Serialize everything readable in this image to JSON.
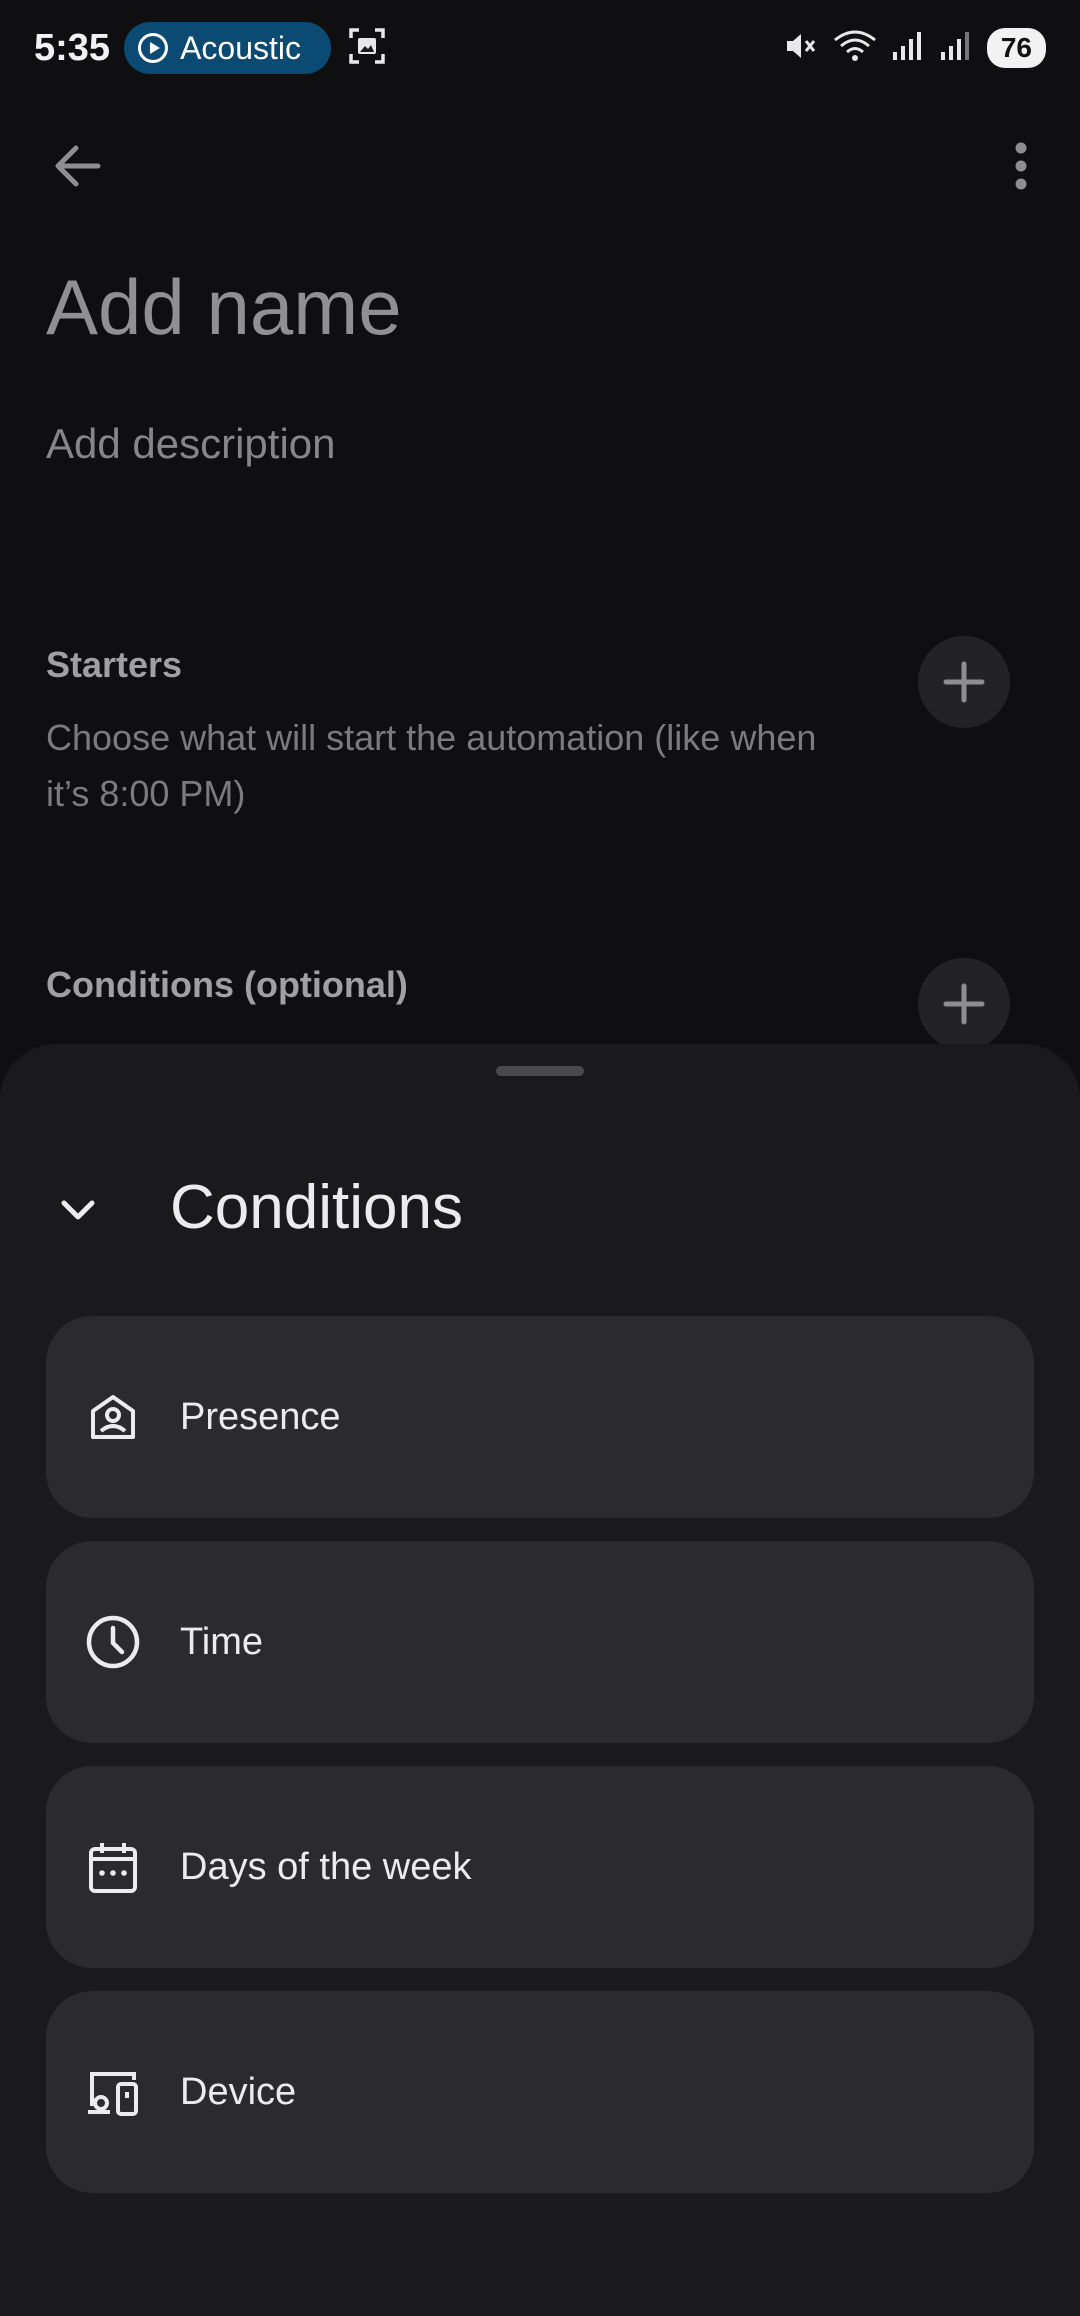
{
  "status_bar": {
    "time": "5:35",
    "media_label": "Acoustic",
    "battery": "76"
  },
  "page": {
    "name_placeholder": "Add name",
    "description_placeholder": "Add description"
  },
  "starters": {
    "title": "Starters",
    "subtitle": "Choose what will start the automation (like when it’s 8:00 PM)"
  },
  "conditions_section": {
    "title": "Conditions (optional)"
  },
  "sheet": {
    "title": "Conditions",
    "options": [
      {
        "label": "Presence",
        "icon": "presence-icon"
      },
      {
        "label": "Time",
        "icon": "clock-icon"
      },
      {
        "label": "Days of the week",
        "icon": "calendar-icon"
      },
      {
        "label": "Device",
        "icon": "device-icon"
      }
    ]
  },
  "colors": {
    "background": "#0f0f11",
    "sheet": "#1a1a1d",
    "option_card": "#2b2a2f",
    "media_pill": "#0b4a73"
  }
}
